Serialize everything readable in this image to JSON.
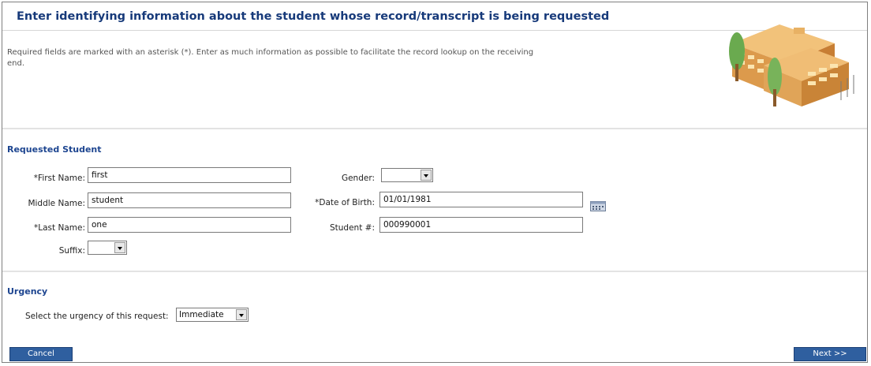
{
  "header": {
    "title": "Enter identifying information about the student whose record/transcript is being requested",
    "intro": "Required fields are marked with an asterisk (*). Enter as much information as possible to facilitate the record lookup on the receiving end."
  },
  "student_section": {
    "title": "Requested Student",
    "first_name": {
      "label": "*First Name:",
      "value": "first"
    },
    "middle_name": {
      "label": "Middle Name:",
      "value": "student"
    },
    "last_name": {
      "label": "*Last Name:",
      "value": "one"
    },
    "suffix": {
      "label": "Suffix:",
      "value": ""
    },
    "gender": {
      "label": "Gender:",
      "value": ""
    },
    "dob": {
      "label": "*Date of Birth:",
      "value": "01/01/1981"
    },
    "student_number": {
      "label": "Student #:",
      "value": "000990001"
    }
  },
  "urgency_section": {
    "title": "Urgency",
    "label": "Select the urgency of this request:",
    "value": "Immediate"
  },
  "buttons": {
    "cancel": "Cancel",
    "next": "Next >>"
  }
}
